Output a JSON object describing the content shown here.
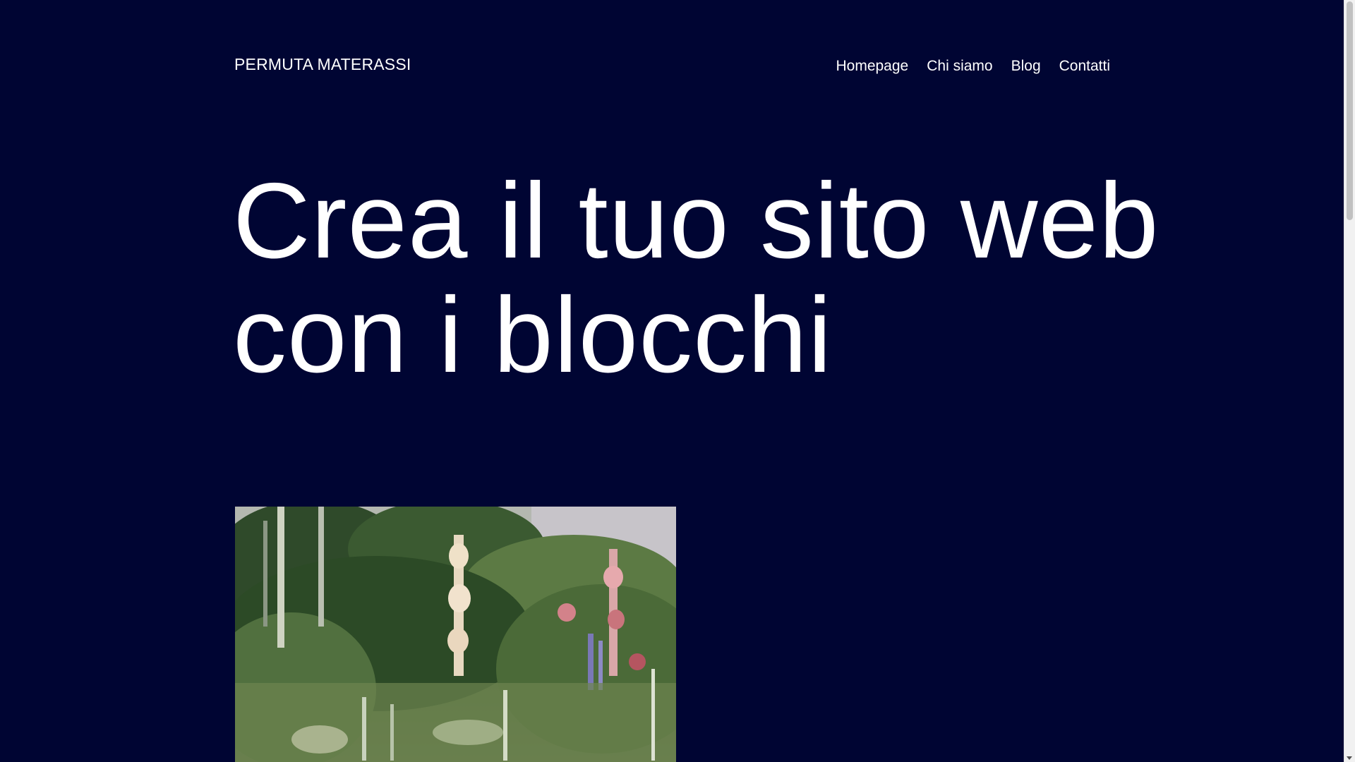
{
  "header": {
    "site_title": "PERMUTA MATERASSI",
    "nav": [
      {
        "label": "Homepage"
      },
      {
        "label": "Chi siamo"
      },
      {
        "label": "Blog"
      },
      {
        "label": "Contatti"
      }
    ]
  },
  "hero": {
    "title_line1": "Crea il tuo sito web",
    "title_line2": "con i blocchi",
    "image_alt": "Impressionist garden painting with hollyhocks"
  },
  "colors": {
    "background": "#000533",
    "text": "#ffffff"
  }
}
